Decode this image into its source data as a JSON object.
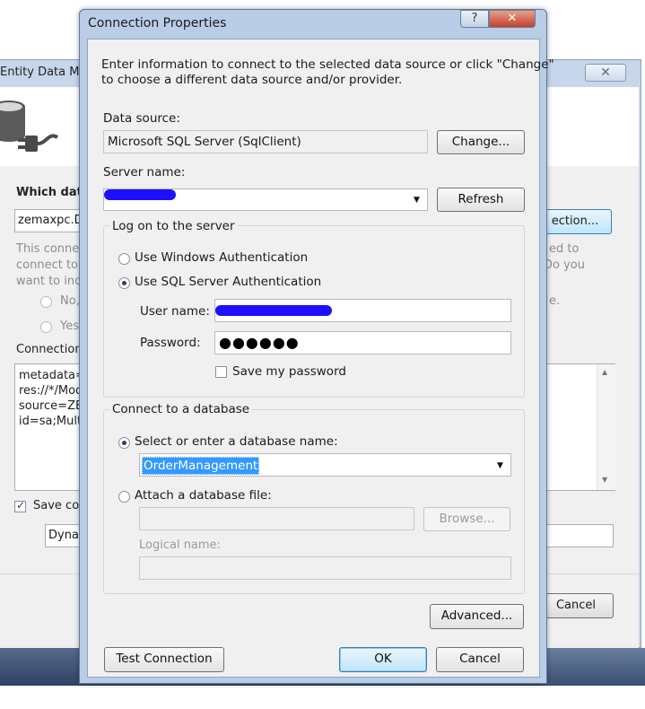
{
  "background_window": {
    "title": "Entity Data Mo",
    "close_glyph": "✕",
    "question": "Which data",
    "connection_combo": "zemaxpc.D",
    "new_connection_button": "ection...",
    "grey_left": [
      "This conne",
      "connect to",
      "want to inc"
    ],
    "grey_right": [
      "ed to",
      "Do you",
      "e."
    ],
    "radio_no": "No,",
    "radio_yes": "Yes",
    "connection_label": "Connection",
    "connection_string_lines": [
      "metadata=",
      "res://*/Mod",
      "source=ZEN",
      "id=sa;Multi"
    ],
    "save_checkbox_label": "Save con",
    "entity_name_value": "Dyna",
    "cancel_button": "Cancel"
  },
  "dialog": {
    "title": "Connection Properties",
    "help_glyph": "?",
    "close_glyph": "✕",
    "intro_line1": "Enter information to connect to the selected data source or click \"Change\"",
    "intro_line2": "to choose a different data source and/or provider.",
    "data_source_label": "Data source:",
    "data_source_value": "Microsoft SQL Server (SqlClient)",
    "change_button": "Change...",
    "server_name_label": "Server name:",
    "refresh_button": "Refresh",
    "logon_group_label": "Log on to the server",
    "windows_auth_label": "Use Windows Authentication",
    "sql_auth_label": "Use SQL Server Authentication",
    "username_label": "User name:",
    "password_label": "Password:",
    "password_value": "●●●●●●",
    "save_password_label": "Save my password",
    "database_group_label": "Connect to a database",
    "select_db_label": "Select or enter a database name:",
    "database_name_value": "OrderManagement",
    "attach_db_label": "Attach a database file:",
    "browse_button": "Browse...",
    "logical_name_label": "Logical name:",
    "advanced_button": "Advanced...",
    "test_connection_button": "Test Connection",
    "ok_button": "OK",
    "cancel_button": "Cancel"
  },
  "colors": {
    "dialog_frame": "#b9cde6",
    "client_bg": "#f0f0f0",
    "close_button": "#c1412a",
    "selection": "#3399ff",
    "redaction": "#1c10ff"
  },
  "icons": [
    "database-icon",
    "plug-icon",
    "help-icon",
    "close-icon",
    "dropdown-arrow-icon",
    "scroll-up-icon",
    "scroll-down-icon"
  ]
}
